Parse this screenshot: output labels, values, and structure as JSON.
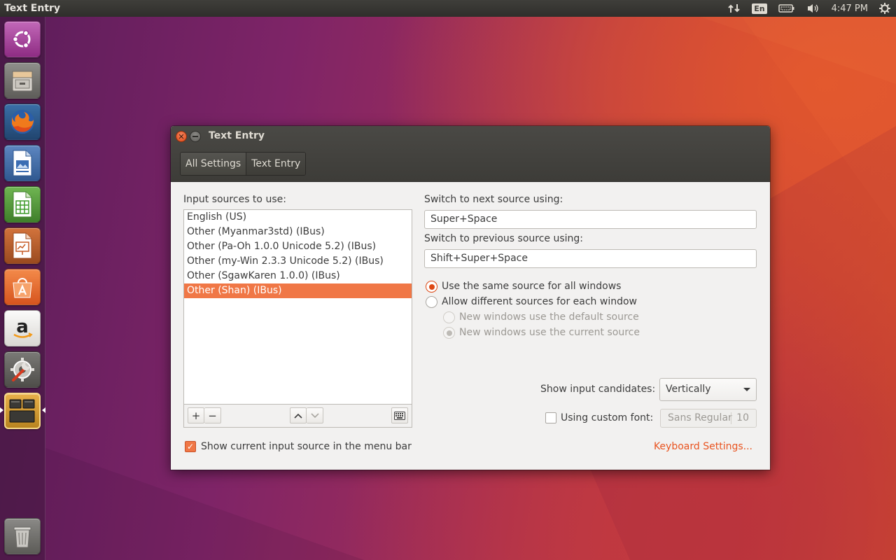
{
  "top_panel": {
    "app_title": "Text Entry",
    "language_indicator": "En",
    "clock": "4:47 PM",
    "icons": [
      "network-arrows-icon",
      "battery-icon",
      "volume-icon",
      "gear-icon"
    ]
  },
  "launcher": {
    "items": [
      {
        "name": "ubuntu-dash",
        "icon": "ubuntu-logo-icon"
      },
      {
        "name": "files",
        "icon": "file-cabinet-icon"
      },
      {
        "name": "firefox",
        "icon": "firefox-icon"
      },
      {
        "name": "libreoffice-writer",
        "icon": "writer-icon"
      },
      {
        "name": "libreoffice-calc",
        "icon": "calc-icon"
      },
      {
        "name": "libreoffice-impress",
        "icon": "impress-icon"
      },
      {
        "name": "ubuntu-software",
        "icon": "software-center-icon"
      },
      {
        "name": "amazon",
        "icon": "amazon-icon"
      },
      {
        "name": "system-settings",
        "icon": "settings-wrench-icon"
      },
      {
        "name": "text-entry",
        "icon": "text-entry-icon"
      },
      {
        "name": "trash",
        "icon": "trash-icon"
      }
    ]
  },
  "window": {
    "title": "Text Entry",
    "breadcrumbs": {
      "all_settings": "All Settings",
      "text_entry": "Text Entry"
    },
    "input_sources_label": "Input sources to use:",
    "input_sources": [
      {
        "label": "English (US)",
        "selected": false
      },
      {
        "label": "Other (Myanmar3std) (IBus)",
        "selected": false
      },
      {
        "label": "Other (Pa-Oh 1.0.0 Unicode 5.2) (IBus)",
        "selected": false
      },
      {
        "label": "Other (my-Win 2.3.3 Unicode 5.2) (IBus)",
        "selected": false
      },
      {
        "label": "Other (SgawKaren 1.0.0) (IBus)",
        "selected": false
      },
      {
        "label": "Other (Shan) (IBus)",
        "selected": true
      }
    ],
    "list_toolbar": {
      "add": "+",
      "remove": "−"
    },
    "next_source_label": "Switch to next source using:",
    "next_source_value": "Super+Space",
    "prev_source_label": "Switch to previous source using:",
    "prev_source_value": "Shift+Super+Space",
    "radio_same": "Use the same source for all windows",
    "radio_different": "Allow different sources for each window",
    "radio_default": "New windows use the default source",
    "radio_current": "New windows use the current source",
    "candidates_label": "Show input candidates:",
    "candidates_value": "Vertically",
    "custom_font_label": "Using custom font:",
    "custom_font_name": "Sans Regular",
    "custom_font_size": "10",
    "show_in_menubar_label": "Show current input source in the menu bar",
    "show_in_menubar_checked": true,
    "keyboard_settings_link": "Keyboard Settings..."
  },
  "colors": {
    "accent": "#e95420",
    "selection": "#f07746",
    "panel": "#3c3b37"
  }
}
